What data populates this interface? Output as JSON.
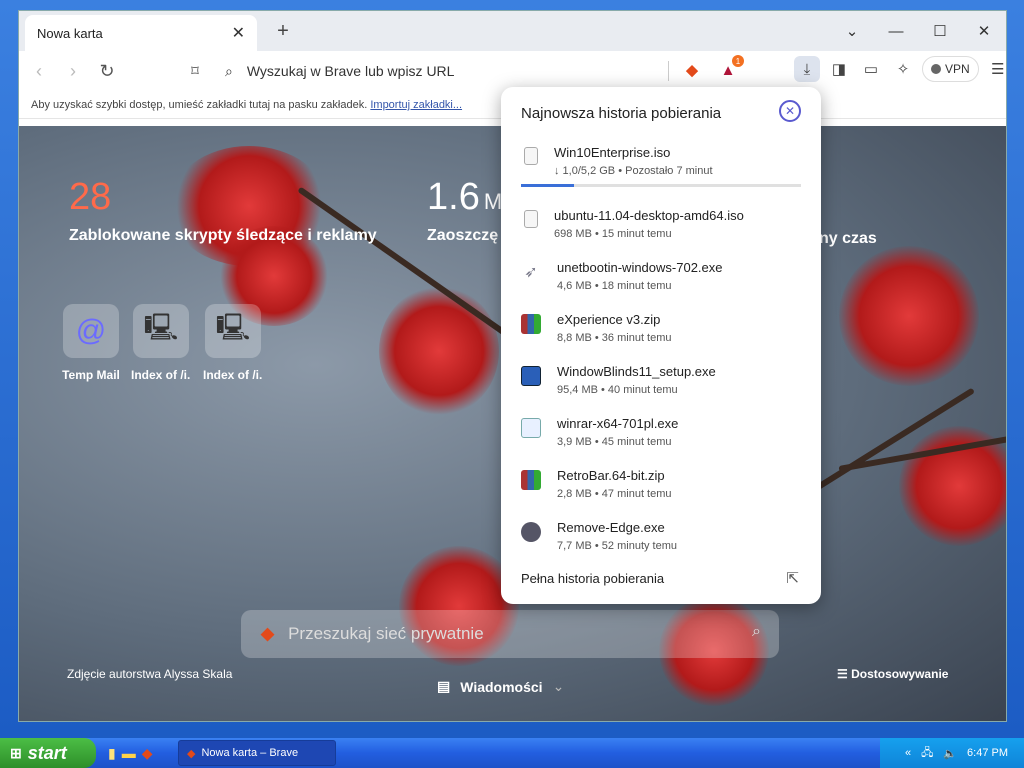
{
  "browser": {
    "tab_title": "Nowa karta",
    "omnibox_placeholder": "Wyszukaj w Brave lub wpisz URL",
    "vpn_label": "VPN",
    "rewards_badge": "1"
  },
  "bookmarks": {
    "text": "Aby uzyskać szybki dostęp, umieść zakładki tutaj na pasku zakładek.",
    "link": "Importuj zakładki..."
  },
  "stats": [
    {
      "number": "28",
      "label": "Zablokowane skrypty śledzące i reklamy",
      "color": "#ff6a4a"
    },
    {
      "number": "1.6",
      "unit": "M",
      "label": "Zaoszczę"
    },
    {
      "label_tail": "ny czas"
    }
  ],
  "shortcuts": [
    {
      "label": "Temp Mail",
      "icon": "at-icon"
    },
    {
      "label": "Index of /i...",
      "icon": "computer-icon"
    },
    {
      "label": "Index of /i...",
      "icon": "computer-icon"
    }
  ],
  "search": {
    "placeholder": "Przeszukaj sieć prywatnie"
  },
  "footer": {
    "credit": "Zdjęcie autorstwa Alyssa Skala",
    "news": "Wiadomości",
    "customize": "Dostosowywanie"
  },
  "downloads": {
    "title": "Najnowsza historia pobierania",
    "items": [
      {
        "name": "Win10Enterprise.iso",
        "meta": "↓ 1,0/5,2 GB • Pozostało 7 minut",
        "progress": 0.19,
        "icon": "file-icon"
      },
      {
        "name": "ubuntu-11.04-desktop-amd64.iso",
        "meta": "698 MB • 15 minut temu",
        "icon": "file-icon"
      },
      {
        "name": "unetbootin-windows-702.exe",
        "meta": "4,6 MB • 18 minut temu",
        "icon": "rocket-icon"
      },
      {
        "name": "eXperience v3.zip",
        "meta": "8,8 MB • 36 minut temu",
        "icon": "winrar-icon"
      },
      {
        "name": "WindowBlinds11_setup.exe",
        "meta": "95,4 MB • 40 minut temu",
        "icon": "windowblinds-icon"
      },
      {
        "name": "winrar-x64-701pl.exe",
        "meta": "3,9 MB • 45 minut temu",
        "icon": "installer-icon"
      },
      {
        "name": "RetroBar.64-bit.zip",
        "meta": "2,8 MB • 47 minut temu",
        "icon": "winrar-icon"
      },
      {
        "name": "Remove-Edge.exe",
        "meta": "7,7 MB • 52 minuty temu",
        "icon": "edge-icon"
      }
    ],
    "full_history": "Pełna historia pobierania"
  },
  "taskbar": {
    "start": "start",
    "task": "Nowa karta – Brave",
    "clock": "6:47 PM"
  }
}
